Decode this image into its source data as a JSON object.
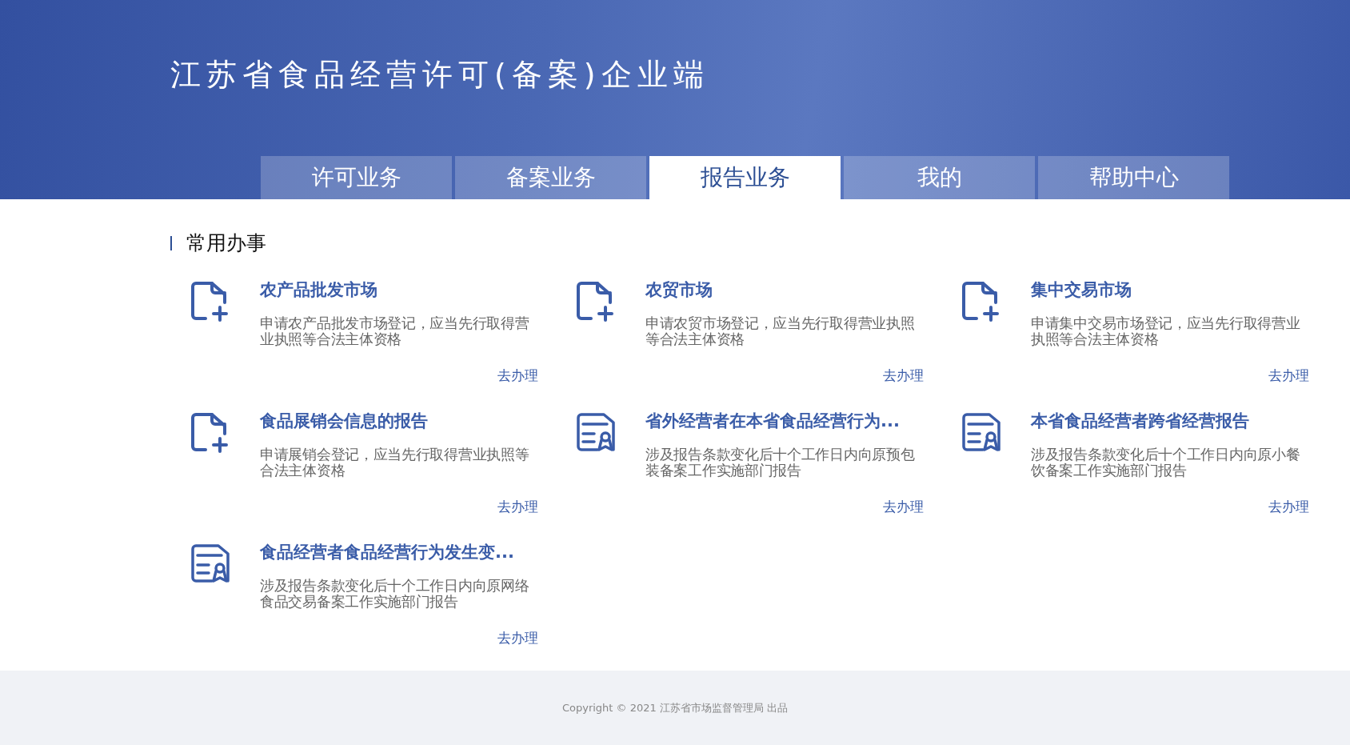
{
  "header": {
    "title": "江苏省食品经营许可(备案)企业端"
  },
  "tabs": [
    {
      "label": "许可业务",
      "selected": false
    },
    {
      "label": "备案业务",
      "selected": false
    },
    {
      "label": "报告业务",
      "selected": true
    },
    {
      "label": "我的",
      "selected": false
    },
    {
      "label": "帮助中心",
      "selected": false
    }
  ],
  "section": {
    "title": "常用办事"
  },
  "services": [
    {
      "kind": "new",
      "title": "农产品批发市场",
      "description": "申请农产品批发市场登记，应当先行取得营业执照等合法主体资格",
      "action": "去办理"
    },
    {
      "kind": "new",
      "title": "农贸市场",
      "description": "申请农贸市场登记，应当先行取得营业执照等合法主体资格",
      "action": "去办理"
    },
    {
      "kind": "new",
      "title": "集中交易市场",
      "description": "申请集中交易市场登记，应当先行取得营业执照等合法主体资格",
      "action": "去办理"
    },
    {
      "kind": "new",
      "title": "食品展销会信息的报告",
      "description": "申请展销会登记，应当先行取得营业执照等合法主体资格",
      "action": "去办理"
    },
    {
      "kind": "report",
      "title": "省外经营者在本省食品经营行为...",
      "description": "涉及报告条款变化后十个工作日内向原预包装备案工作实施部门报告",
      "action": "去办理"
    },
    {
      "kind": "report",
      "title": "本省食品经营者跨省经营报告",
      "description": "涉及报告条款变化后十个工作日内向原小餐饮备案工作实施部门报告",
      "action": "去办理"
    },
    {
      "kind": "report",
      "title": "食品经营者食品经营行为发生变...",
      "description": "涉及报告条款变化后十个工作日内向原网络食品交易备案工作实施部门报告",
      "action": "去办理"
    }
  ],
  "footer": {
    "copyright": "Copyright © 2021 江苏省市场监督管理局 出品"
  }
}
